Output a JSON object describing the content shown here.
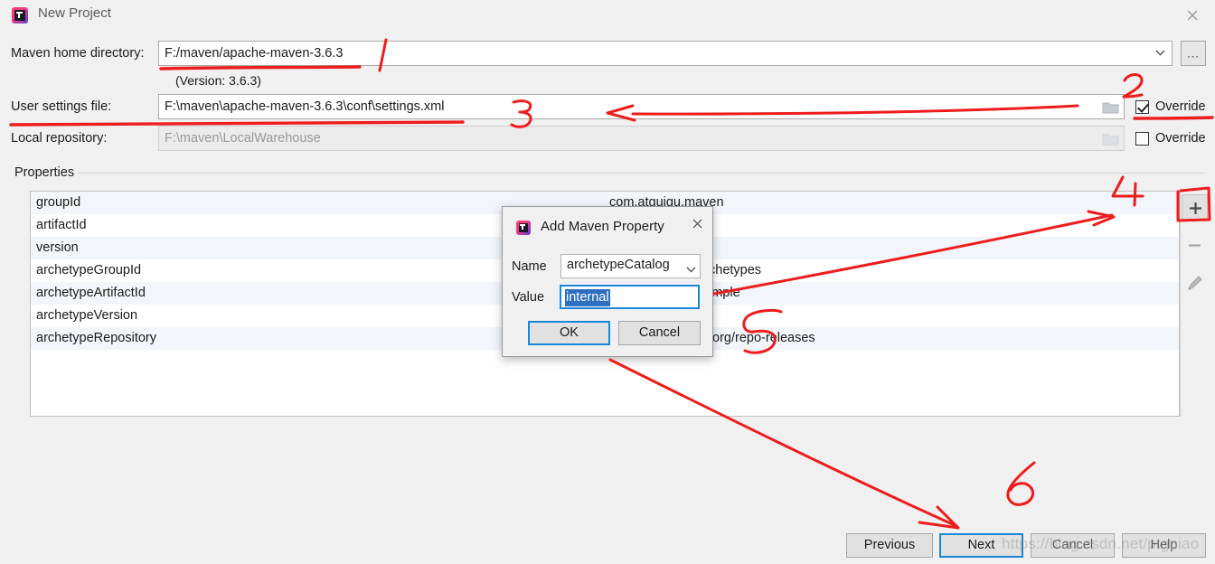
{
  "window": {
    "title": "New Project",
    "icon": "intellij-idea-icon",
    "close_icon": "close-icon"
  },
  "form": {
    "maven_home": {
      "label": "Maven home directory:",
      "value": "F:/maven/apache-maven-3.6.3",
      "dropdown_icon": "chevron-down-icon",
      "browse_label": "...",
      "version_note": "(Version: 3.6.3)"
    },
    "user_settings": {
      "label": "User settings file:",
      "value": "F:\\maven\\apache-maven-3.6.3\\conf\\settings.xml",
      "folder_icon": "folder-icon",
      "override_label": "Override",
      "override_checked": true
    },
    "local_repository": {
      "label": "Local repository:",
      "value": "F:\\maven\\LocalWarehouse",
      "folder_icon": "folder-icon",
      "override_label": "Override",
      "override_checked": false
    }
  },
  "properties": {
    "group_label": "Properties",
    "rows": [
      {
        "key": "groupId",
        "value": "com.atguigu.maven"
      },
      {
        "key": "artifactId",
        "value": ""
      },
      {
        "key": "version",
        "value": ""
      },
      {
        "key": "archetypeGroupId",
        "value": "chetypes"
      },
      {
        "key": "archetypeArtifactId",
        "value": "imple"
      },
      {
        "key": "archetypeVersion",
        "value": ""
      },
      {
        "key": "archetypeRepository",
        "value": ".org/repo-releases"
      }
    ],
    "toolbar": {
      "add_label": "+",
      "add_icon": "plus-icon",
      "remove_label": "−",
      "remove_icon": "minus-icon",
      "edit_icon": "pencil-icon"
    }
  },
  "dialog": {
    "title": "Add Maven Property",
    "icon": "intellij-idea-icon",
    "close_icon": "close-icon",
    "name_label": "Name",
    "name_value": "archetypeCatalog",
    "name_dropdown_icon": "chevron-down-icon",
    "value_label": "Value",
    "value_value": "internal",
    "ok_label": "OK",
    "cancel_label": "Cancel"
  },
  "footer": {
    "previous_label": "Previous",
    "next_label": "Next",
    "cancel_label": "Cancel",
    "help_label": "Help"
  },
  "watermark": {
    "text": "https://blog.csdn.net/ptgniao"
  },
  "annotations": {
    "marks": [
      {
        "name": "stroke-maven-home-underline",
        "type": "underline"
      },
      {
        "name": "stroke-slash-after-maven-home",
        "type": "slash"
      },
      {
        "name": "numeral-2-near-override",
        "type": "numeral",
        "text": "2"
      },
      {
        "name": "underline-override-checkbox",
        "type": "underline"
      },
      {
        "name": "numeral-3-near-settings",
        "type": "numeral",
        "text": "3"
      },
      {
        "name": "underline-user-settings",
        "type": "underline"
      },
      {
        "name": "arrow-to-user-settings",
        "type": "arrow"
      },
      {
        "name": "numeral-4-near-add-button",
        "type": "numeral",
        "text": "4"
      },
      {
        "name": "box-around-add-button",
        "type": "box"
      },
      {
        "name": "arrow-to-add-button",
        "type": "arrow"
      },
      {
        "name": "numeral-5-near-dialog",
        "type": "numeral",
        "text": "5"
      },
      {
        "name": "arrow-to-next-button",
        "type": "arrow"
      },
      {
        "name": "numeral-6-near-next-button",
        "type": "numeral",
        "text": "6"
      }
    ],
    "color": "#ee1c1c"
  },
  "colors": {
    "window_bg": "#f0f0f0",
    "field_bg": "#ffffff",
    "row_alt_bg": "#f2f5f9",
    "focus_border": "#1787d7",
    "selection_bg": "#2f6fc0",
    "annotation_red": "#ee1c1c"
  }
}
